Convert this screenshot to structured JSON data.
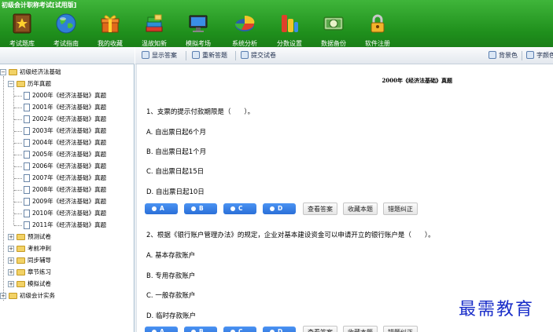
{
  "app": {
    "title": "初级会计职称考试[试用版]"
  },
  "toolbar": {
    "items": [
      {
        "label": "考试题库",
        "icon": "star-book-icon"
      },
      {
        "label": "考试指南",
        "icon": "globe-icon"
      },
      {
        "label": "我的收藏",
        "icon": "gift-box-icon"
      },
      {
        "label": "温故知新",
        "icon": "books-icon"
      },
      {
        "label": "模拟考场",
        "icon": "monitor-icon"
      },
      {
        "label": "系统分析",
        "icon": "pie-chart-icon"
      },
      {
        "label": "分数设置",
        "icon": "score-settings-icon"
      },
      {
        "label": "数据备份",
        "icon": "money-backup-icon"
      },
      {
        "label": "软件注册",
        "icon": "lock-icon"
      }
    ]
  },
  "tree": {
    "root": "初级经济法基础",
    "group": "历年真题",
    "years": [
      "2000年《经济法基础》真题",
      "2001年《经济法基础》真题",
      "2002年《经济法基础》真题",
      "2003年《经济法基础》真题",
      "2004年《经济法基础》真题",
      "2005年《经济法基础》真题",
      "2006年《经济法基础》真题",
      "2007年《经济法基础》真题",
      "2008年《经济法基础》真题",
      "2009年《经济法基础》真题",
      "2010年《经济法基础》真题",
      "2011年《经济法基础》真题"
    ],
    "other_groups": [
      "预测试卷",
      "考前冲刺",
      "同步辅导",
      "章节练习",
      "模拟试卷"
    ],
    "second_root": "初级会计实务"
  },
  "content_toolbar": {
    "show_answer": "显示答案",
    "restart": "重新答题",
    "submit": "提交试卷",
    "background": "背景色",
    "font": "字颜色"
  },
  "paper": {
    "title": "2000年《经济法基础》真题",
    "questions": [
      {
        "stem": "1、支票的提示付款期限是（　　）。",
        "options": [
          "A. 自出票日起6个月",
          "B. 自出票日起1个月",
          "C. 自出票日起15日",
          "D. 自出票日起10日"
        ]
      },
      {
        "stem": "2、根据《银行账户管理办法》的规定，企业对基本建设资金可以申请开立的银行账户是（　　）。",
        "options": [
          "A. 基本存款账户",
          "B. 专用存款账户",
          "C. 一般存款账户",
          "D. 临时存款账户"
        ]
      }
    ],
    "answer_choices": [
      "A",
      "B",
      "C",
      "D"
    ],
    "actions": [
      "查看答案",
      "收藏本题",
      "错题纠正"
    ]
  },
  "watermark": "最需教育",
  "colors": {
    "toolbar_green": "#2a9e26",
    "choice_blue": "#3a80e6",
    "watermark_blue": "#1a2ec9"
  }
}
